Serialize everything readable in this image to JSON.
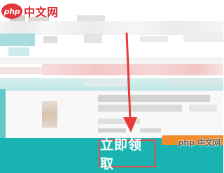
{
  "watermark": {
    "logo_text": "php",
    "site_text": "中文网"
  },
  "bottom_bar": {
    "claim_label": "立即领取"
  },
  "corner_watermark": {
    "text": "php 中文网"
  },
  "colors": {
    "teal": "#19b4b1",
    "highlight_red": "#e54f4a",
    "arrow_red": "#e83a36",
    "watermark_red": "#d9282e",
    "orange_tab": "#f28c2b"
  },
  "icons": {
    "pointer": "arrow-down-icon"
  }
}
